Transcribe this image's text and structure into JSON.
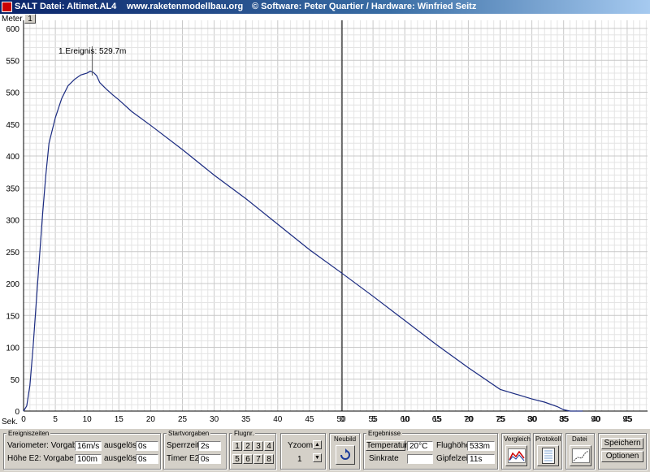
{
  "titlebar": {
    "title": "SALT Datei: Altimet.AL4",
    "website": "www.raketenmodellbau.org",
    "credits": "©  Software: Peter Quartier / Hardware: Winfried Seitz"
  },
  "plot": {
    "y_unit_label": "Meter",
    "x_unit_label": "Sek.",
    "tab_label": "1",
    "annotation": "1.Ereignis: 529.7m"
  },
  "chart_data": {
    "type": "line",
    "title": "",
    "xlabel": "Sek.",
    "ylabel": "Meter",
    "xlim": [
      0,
      95
    ],
    "ylim": [
      0,
      600
    ],
    "grid": true,
    "x_ticks": [
      "0",
      "5",
      "10",
      "15",
      "20",
      "25",
      "30",
      "35",
      "40",
      "45",
      "50",
      "55",
      "60",
      "65",
      "70",
      "75",
      "80",
      "85",
      "90",
      "95",
      "0",
      "5",
      "10",
      "15",
      "20",
      "25",
      "30",
      "35",
      "40",
      "45",
      "50",
      "55",
      "60",
      "65",
      "70",
      "75",
      "80",
      "85",
      "90",
      "95"
    ],
    "y_ticks": [
      "0",
      "50",
      "100",
      "150",
      "200",
      "250",
      "300",
      "350",
      "400",
      "450",
      "500",
      "550",
      "600"
    ],
    "series": [
      {
        "color": "#1a2a80",
        "x": [
          0,
          0.5,
          1,
          1.5,
          2,
          2.5,
          3,
          3.5,
          4,
          5,
          6,
          7,
          8,
          9,
          10,
          10.5,
          11,
          11.5,
          12,
          13,
          14,
          15,
          17,
          20,
          25,
          30,
          35,
          40,
          45,
          50,
          55,
          60,
          65,
          70,
          75,
          80,
          82,
          84,
          85,
          86,
          87,
          88
        ],
        "y": [
          0,
          8,
          40,
          100,
          170,
          240,
          310,
          370,
          420,
          460,
          490,
          510,
          520,
          527,
          530,
          533,
          531,
          526,
          515,
          505,
          496,
          488,
          470,
          448,
          410,
          370,
          333,
          293,
          253,
          217,
          180,
          142,
          104,
          68,
          34,
          19,
          14,
          7,
          2,
          0,
          0,
          0
        ]
      }
    ]
  },
  "controls": {
    "ereigniszeiten": {
      "title": "Ereigniszeiten",
      "variometer_label": "Variometer: Vorgabe",
      "variometer_value": "16m/s",
      "variometer_ausgeloest_label": "ausgelöst",
      "variometer_ausgeloest_value": "0s",
      "hoehe_label": "Höhe E2:  Vorgabe",
      "hoehe_value": "100m",
      "hoehe_ausgeloest_label": "ausgelöst",
      "hoehe_ausgeloest_value": "0s"
    },
    "startvorgaben": {
      "title": "Startvorgaben",
      "sperrzeit_label": "Sperrzeit",
      "sperrzeit_value": "2s",
      "timer_label": "Timer E2",
      "timer_value": "0s"
    },
    "flugnr": {
      "title": "Flugnr.",
      "buttons": [
        "1",
        "2",
        "3",
        "4",
        "5",
        "6",
        "7",
        "8"
      ]
    },
    "yzoom": {
      "label": "Yzoom",
      "value": "1"
    },
    "neubild": {
      "label": "Neubild",
      "icon": "refresh-icon"
    },
    "ergebnisse": {
      "title": "Ergebnisse",
      "temperatur_label": "Temperatur",
      "temperatur_value": "20°C",
      "sinkrate_label": "Sinkrate",
      "sinkrate_value": "",
      "flughoehe_label": "Flughöhe",
      "flughoehe_value": "533m",
      "gipfelzeit_label": "Gipfelzeit",
      "gipfelzeit_value": "11s"
    },
    "vergleich": {
      "label": "Vergleich",
      "icon": "compare-chart-icon"
    },
    "protokoll": {
      "label": "Protokoll",
      "icon": "document-icon"
    },
    "datei": {
      "label": "Datei",
      "icon": "file-chart-icon"
    },
    "speichern_label": "Speichern",
    "optionen_label": "Optionen"
  }
}
